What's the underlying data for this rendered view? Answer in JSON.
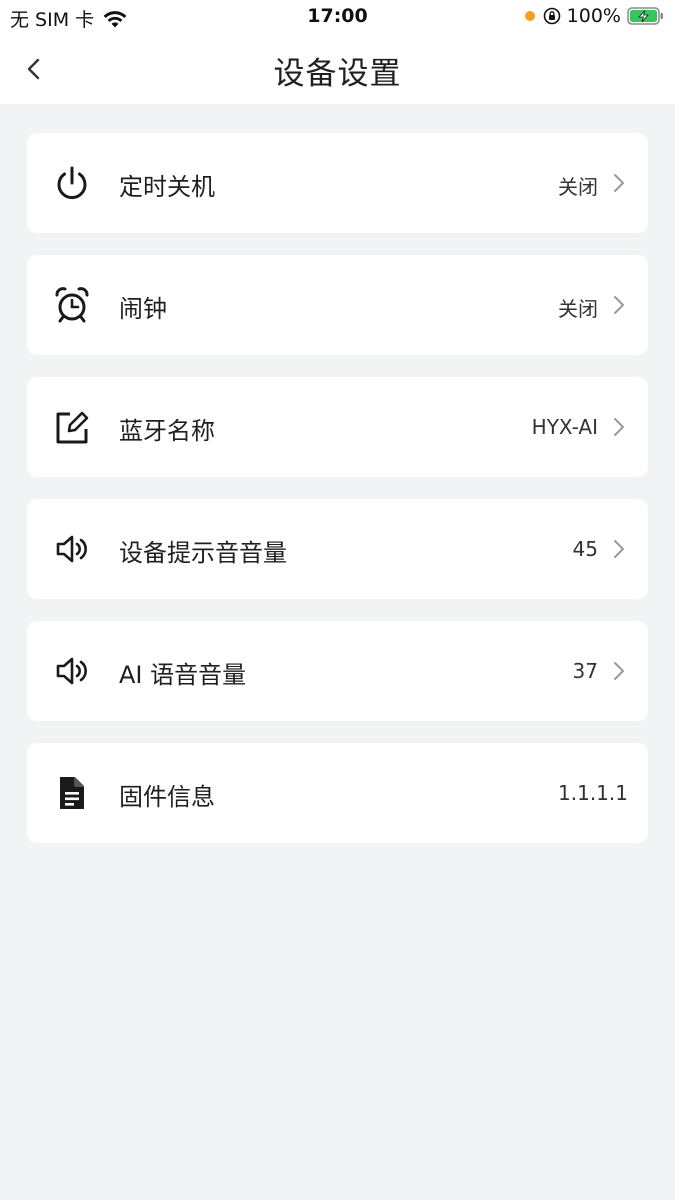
{
  "status_bar": {
    "carrier": "无 SIM 卡",
    "time": "17:00",
    "battery": "100%"
  },
  "header": {
    "title": "设备设置"
  },
  "settings": [
    {
      "label": "定时关机",
      "value": "关闭",
      "icon": "power-icon"
    },
    {
      "label": "闹钟",
      "value": "关闭",
      "icon": "alarm-clock-icon"
    },
    {
      "label": "蓝牙名称",
      "value": "HYX-AI",
      "icon": "edit-icon"
    },
    {
      "label": "设备提示音音量",
      "value": "45",
      "icon": "speaker-icon"
    },
    {
      "label": "AI 语音音量",
      "value": "37",
      "icon": "speaker-icon"
    },
    {
      "label": "固件信息",
      "value": "1.1.1.1",
      "icon": "document-icon"
    }
  ],
  "colors": {
    "background": "#f2f3f5",
    "card": "#ffffff",
    "battery_charging": "#34c759",
    "privacy_dot": "#f6a01a"
  }
}
